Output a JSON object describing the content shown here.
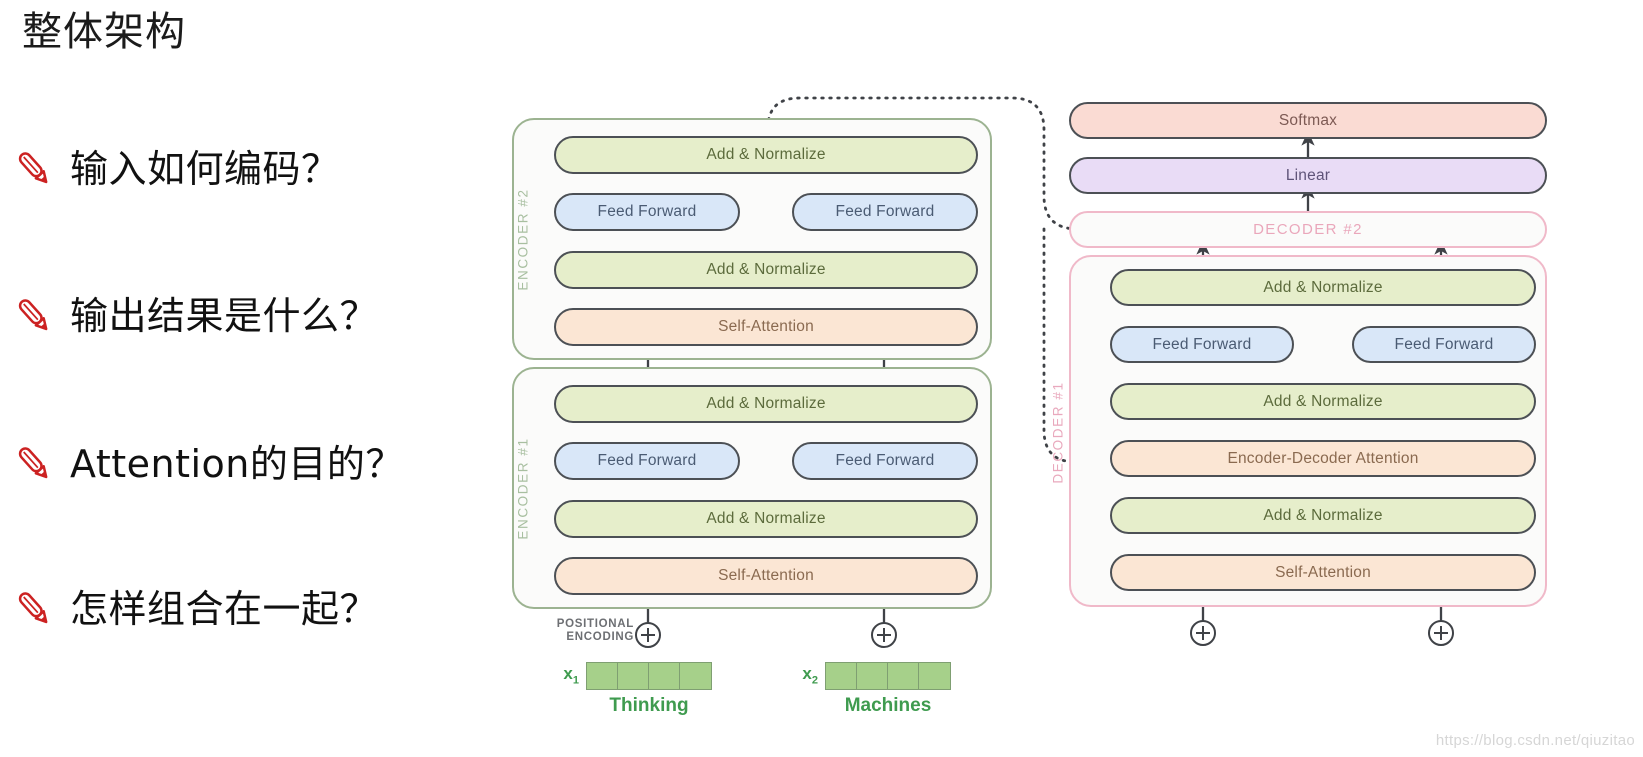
{
  "slide": {
    "title": "整体架构",
    "bullets": [
      {
        "icon": "pencil-icon",
        "text": "输入如何编码？"
      },
      {
        "icon": "pencil-icon",
        "text": "输出结果是什么？"
      },
      {
        "icon": "pencil-icon",
        "text": "Attention的目的？"
      },
      {
        "icon": "pencil-icon",
        "text": "怎样组合在一起？"
      }
    ]
  },
  "diagram": {
    "encoders": [
      {
        "label": "ENCODER #2",
        "layers": [
          {
            "name": "add-normalize",
            "text": "Add & Normalize",
            "style": "addnorm"
          },
          {
            "name": "feed-forward",
            "text": "Feed Forward",
            "style": "ff"
          },
          {
            "name": "feed-forward",
            "text": "Feed Forward",
            "style": "ff"
          },
          {
            "name": "add-normalize",
            "text": "Add & Normalize",
            "style": "addnorm"
          },
          {
            "name": "self-attention",
            "text": "Self-Attention",
            "style": "attn"
          }
        ]
      },
      {
        "label": "ENCODER #1",
        "layers": [
          {
            "name": "add-normalize",
            "text": "Add & Normalize",
            "style": "addnorm"
          },
          {
            "name": "feed-forward",
            "text": "Feed Forward",
            "style": "ff"
          },
          {
            "name": "feed-forward",
            "text": "Feed Forward",
            "style": "ff"
          },
          {
            "name": "add-normalize",
            "text": "Add & Normalize",
            "style": "addnorm"
          },
          {
            "name": "self-attention",
            "text": "Self-Attention",
            "style": "attn"
          }
        ]
      }
    ],
    "decoders": [
      {
        "label": "DECODER #2",
        "collapsed": true
      },
      {
        "label": "DECODER #1",
        "layers": [
          {
            "name": "add-normalize",
            "text": "Add & Normalize",
            "style": "addnorm"
          },
          {
            "name": "feed-forward",
            "text": "Feed Forward",
            "style": "ff"
          },
          {
            "name": "feed-forward",
            "text": "Feed Forward",
            "style": "ff"
          },
          {
            "name": "add-normalize",
            "text": "Add & Normalize",
            "style": "addnorm"
          },
          {
            "name": "encoder-decoder-attention",
            "text": "Encoder-Decoder Attention",
            "style": "attn"
          },
          {
            "name": "add-normalize",
            "text": "Add & Normalize",
            "style": "addnorm"
          },
          {
            "name": "self-attention",
            "text": "Self-Attention",
            "style": "attn"
          }
        ]
      }
    ],
    "output_head": [
      {
        "name": "softmax",
        "text": "Softmax",
        "style": "softmax"
      },
      {
        "name": "linear",
        "text": "Linear",
        "style": "linear"
      }
    ],
    "positional_encoding": {
      "label_line1": "POSITIONAL",
      "label_line2": "ENCODING",
      "symbol": "plus-circle-icon"
    },
    "embeddings": [
      {
        "symbol": "x",
        "subscript": "1",
        "word": "Thinking",
        "cells": 4
      },
      {
        "symbol": "x",
        "subscript": "2",
        "word": "Machines",
        "cells": 4
      }
    ]
  },
  "watermark": "https://blog.csdn.net/qiuzitao",
  "colors": {
    "add_normalize": "#e6eecb",
    "feed_forward": "#d9e7f8",
    "attention": "#fbe6d4",
    "softmax": "#fadbd3",
    "linear": "#e9dcf6",
    "encoder_border": "#9cb391",
    "decoder_border": "#f0b9c9",
    "embedding_green": "#a6d08a",
    "word_green": "#3f9b4f",
    "pencil_red": "#cc2222"
  }
}
